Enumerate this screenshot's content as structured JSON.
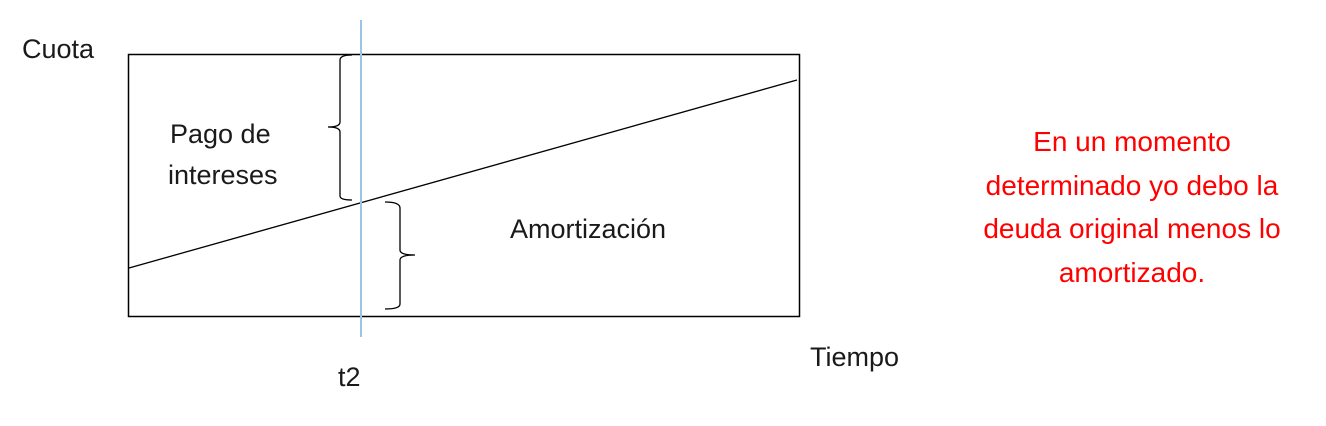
{
  "y_axis_label": "Cuota",
  "x_axis_label": "Tiempo",
  "marker_label": "t2",
  "region_labels": {
    "upper_line1": "Pago de",
    "upper_line2": "intereses",
    "lower": "Amortización"
  },
  "note": {
    "lines": [
      "En un momento",
      "determinado yo debo la",
      "deuda original menos lo",
      "amortizado."
    ],
    "color": "#ff0000"
  },
  "colors": {
    "marker_line": "#9dc3e6",
    "lines": "#000000"
  }
}
